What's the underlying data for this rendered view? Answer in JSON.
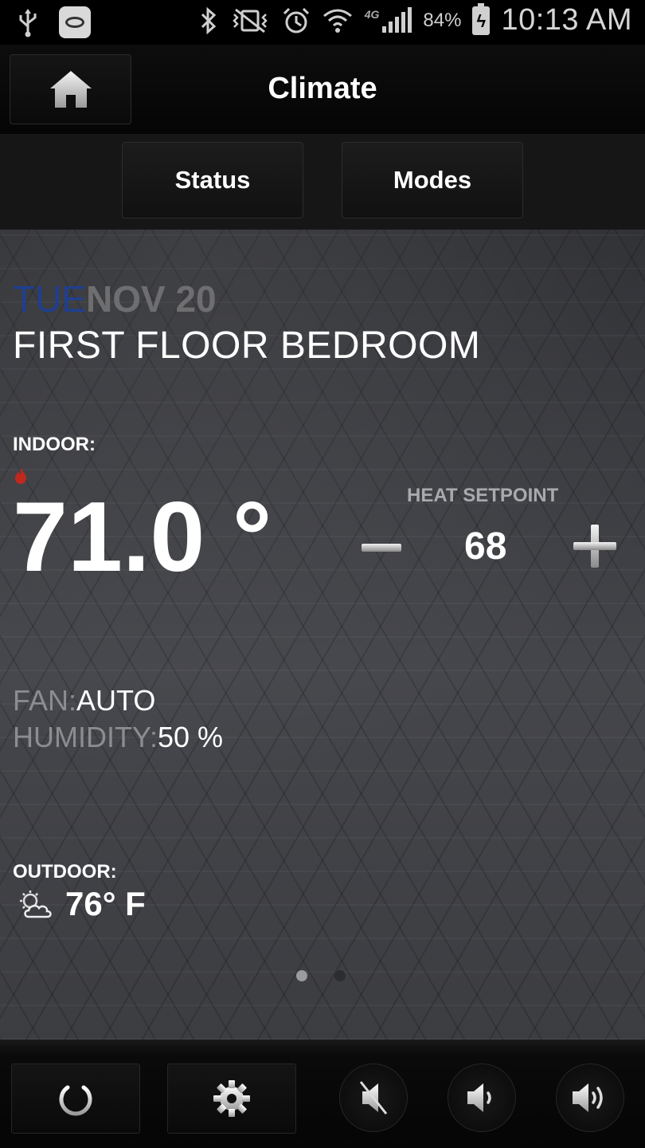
{
  "status_bar": {
    "network": "4G",
    "battery": "84%",
    "time": "10:13 AM",
    "icons": [
      "usb-icon",
      "app-icon",
      "bluetooth-icon",
      "vibrate-mute-icon",
      "alarm-icon",
      "wifi-icon",
      "signal-icon",
      "battery-charging-icon"
    ]
  },
  "header": {
    "title": "Climate",
    "home_icon": "home-icon"
  },
  "tabs": [
    {
      "label": "Status"
    },
    {
      "label": "Modes"
    }
  ],
  "main": {
    "day_of_week": "TUE",
    "month_day": "NOV 20",
    "room": "FIRST FLOOR BEDROOM",
    "indoor": {
      "label": "INDOOR:",
      "temperature": "71.0 °",
      "mode_icon": "flame-icon"
    },
    "setpoint": {
      "label": "HEAT SETPOINT",
      "value": "68"
    },
    "fan": {
      "label": "FAN:",
      "value": "AUTO"
    },
    "humidity": {
      "label": "HUMIDITY:",
      "value": "50 %"
    },
    "outdoor": {
      "label": "OUTDOOR:",
      "temperature": "76° F",
      "icon": "partly-cloudy-icon"
    },
    "pager": {
      "pages": 2,
      "current": 1
    }
  },
  "bottom_bar": {
    "buttons": [
      "power-icon",
      "settings-icon",
      "mute-icon",
      "volume-down-icon",
      "volume-up-icon"
    ]
  },
  "colors": {
    "day_of_week": "#1f3f8f",
    "muted_label": "#8c8d90",
    "flame": "#c0281e"
  }
}
